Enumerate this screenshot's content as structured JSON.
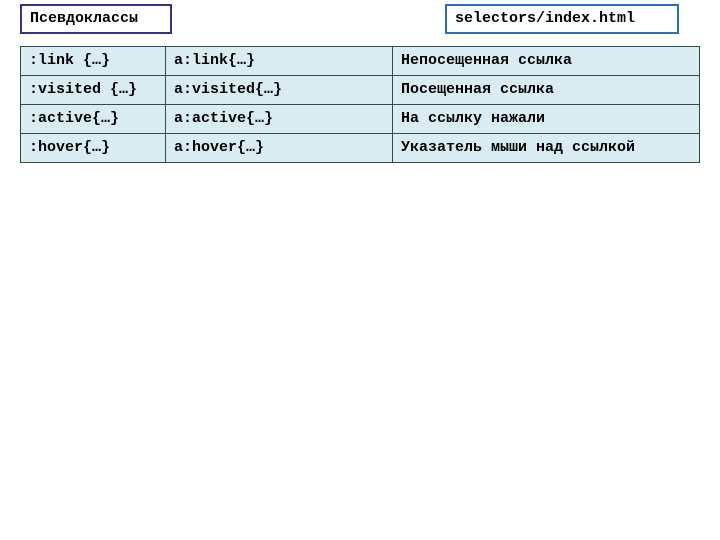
{
  "header": {
    "title": "Псевдоклассы",
    "path": "selectors/index.html"
  },
  "table": {
    "rows": [
      {
        "selector": ":link {…}",
        "example": "a:link{…}",
        "description": "Непосещенная ссылка"
      },
      {
        "selector": ":visited {…}",
        "example": "a:visited{…}",
        "description": "Посещенная ссылка"
      },
      {
        "selector": ":active{…}",
        "example": "a:active{…}",
        "description": "На ссылку нажали"
      },
      {
        "selector": ":hover{…}",
        "example": "a:hover{…}",
        "description": "Указатель мыши над ссылкой"
      }
    ]
  }
}
